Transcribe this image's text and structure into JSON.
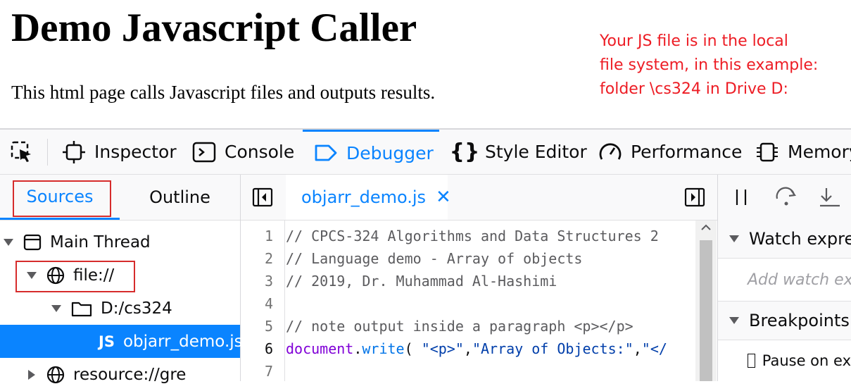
{
  "page": {
    "title": "Demo Javascript Caller",
    "intro": "This html page calls Javascript files and outputs results.",
    "note_lines": [
      "Your JS file is in the local",
      "file system, in this example:",
      "folder \\cs324 in Drive D:"
    ]
  },
  "devtools": {
    "tabs": [
      {
        "label": "Inspector",
        "icon": "inspector-icon"
      },
      {
        "label": "Console",
        "icon": "console-icon"
      },
      {
        "label": "Debugger",
        "icon": "debugger-icon",
        "selected": true
      },
      {
        "label": "Style Editor",
        "icon": "style-editor-icon"
      },
      {
        "label": "Performance",
        "icon": "performance-icon"
      },
      {
        "label": "Memory",
        "icon": "memory-icon"
      }
    ],
    "left_tabs": {
      "sources": "Sources",
      "outline": "Outline"
    },
    "tree": {
      "main_thread": "Main Thread",
      "file_root": "file://",
      "folder": "D:/cs324",
      "file_badge": "JS",
      "file": "objarr_demo.js",
      "resource": "resource://gre"
    },
    "editor": {
      "tab_label": "objarr_demo.js",
      "lines": [
        {
          "n": "1",
          "text": "// CPCS-324 Algorithms and Data Structures 2"
        },
        {
          "n": "2",
          "text": "// Language demo - Array of objects"
        },
        {
          "n": "3",
          "text": "// 2019, Dr. Muhammad Al-Hashimi"
        },
        {
          "n": "4",
          "text": ""
        },
        {
          "n": "5",
          "text": "// note output inside a paragraph <p></p>"
        },
        {
          "n": "6",
          "text": "document.write( \"<p>\",\"Array of Objects:\",\"</"
        },
        {
          "n": "7",
          "text": ""
        }
      ]
    },
    "right": {
      "watch_header": "Watch expres",
      "watch_placeholder": "Add watch exp",
      "breakpoints_header": "Breakpoints",
      "pause_label": "Pause on ex"
    }
  },
  "colors": {
    "accent": "#0a84ff",
    "note": "#ed1c24",
    "highlight_box": "#d62c2c"
  }
}
